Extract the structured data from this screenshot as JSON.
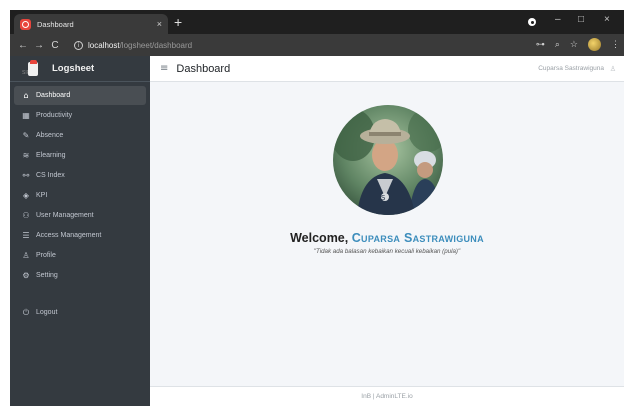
{
  "browser": {
    "tab_title": "Dashboard",
    "tab_close": "×",
    "new_tab": "+",
    "url_host": "localhost",
    "url_path": "/logsheet/dashboard",
    "win_minimize": "–",
    "win_maximize": "□",
    "win_close": "×"
  },
  "app": {
    "brand_name": "Logsheet",
    "page_title": "Dashboard",
    "user_name": "Cuparsa Sastrawiguna"
  },
  "sidebar": {
    "items": [
      {
        "label": "Dashboard",
        "icon": "home-icon",
        "glyph": "⌂",
        "active": true
      },
      {
        "label": "Productivity",
        "icon": "chart-icon",
        "glyph": "▦"
      },
      {
        "label": "Absence",
        "icon": "pencil-icon",
        "glyph": "✎"
      },
      {
        "label": "Elearning",
        "icon": "wifi-icon",
        "glyph": "≋"
      },
      {
        "label": "CS Index",
        "icon": "network-icon",
        "glyph": "⚯"
      },
      {
        "label": "KPI",
        "icon": "layers-icon",
        "glyph": "◈"
      },
      {
        "label": "User Management",
        "icon": "users-icon",
        "glyph": "⚇"
      },
      {
        "label": "Access Management",
        "icon": "list-icon",
        "glyph": "☰"
      },
      {
        "label": "Profile",
        "icon": "user-icon",
        "glyph": "♙"
      },
      {
        "label": "Setting",
        "icon": "gear-icon",
        "glyph": "⚙"
      },
      {
        "label": "Logout",
        "icon": "power-icon",
        "glyph": "⏻"
      }
    ]
  },
  "main": {
    "welcome_prefix": "Welcome,",
    "welcome_name": "Cuparsa Sastrawiguna",
    "quote": "\"Tidak ada balasan kebaikan kecuali kebaikan (pula)\""
  },
  "footer": {
    "text": "InB | AdminLTE.io"
  },
  "colors": {
    "sidebar_bg": "#343a40",
    "accent": "#3c8dbc",
    "content_bg": "#f4f6f9",
    "favicon": "#e8453c"
  }
}
